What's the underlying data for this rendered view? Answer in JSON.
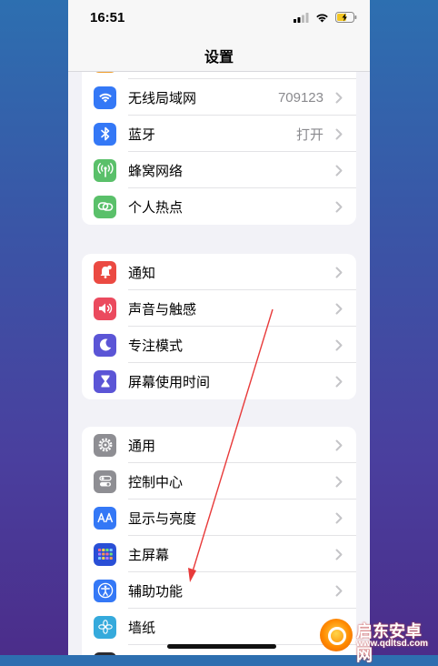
{
  "status_bar": {
    "time": "16:51",
    "icons": [
      "cellular-signal-icon",
      "wifi-icon",
      "battery-charging-icon"
    ]
  },
  "nav": {
    "title": "设置"
  },
  "groups": [
    {
      "rows": [
        {
          "label": "无线局域网",
          "value": "709123",
          "icon": "wifi-icon",
          "color": "#3478f6"
        },
        {
          "label": "蓝牙",
          "value": "打开",
          "icon": "bluetooth-icon",
          "color": "#3478f6"
        },
        {
          "label": "蜂窝网络",
          "value": "",
          "icon": "antenna-icon",
          "color": "#5ac06a"
        },
        {
          "label": "个人热点",
          "value": "",
          "icon": "link-icon",
          "color": "#5ac06a"
        }
      ]
    },
    {
      "rows": [
        {
          "label": "通知",
          "icon": "bell-icon",
          "color": "#eb4a42"
        },
        {
          "label": "声音与触感",
          "icon": "speaker-icon",
          "color": "#eb4a5e"
        },
        {
          "label": "专注模式",
          "icon": "moon-icon",
          "color": "#5b55d6"
        },
        {
          "label": "屏幕使用时间",
          "icon": "hourglass-icon",
          "color": "#5b55d6"
        }
      ]
    },
    {
      "rows": [
        {
          "label": "通用",
          "icon": "gear-icon",
          "color": "#8e8e93"
        },
        {
          "label": "控制中心",
          "icon": "toggles-icon",
          "color": "#8e8e93"
        },
        {
          "label": "显示与亮度",
          "icon": "text-size-icon",
          "color": "#3478f6"
        },
        {
          "label": "主屏幕",
          "icon": "app-grid-icon",
          "color": "#3478f6"
        },
        {
          "label": "辅助功能",
          "icon": "accessibility-icon",
          "color": "#3478f6"
        },
        {
          "label": "墙纸",
          "icon": "flower-icon",
          "color": "#35aadc"
        }
      ]
    }
  ],
  "watermark": {
    "name": "启东安卓网",
    "url": "www.qdltsd.com"
  }
}
